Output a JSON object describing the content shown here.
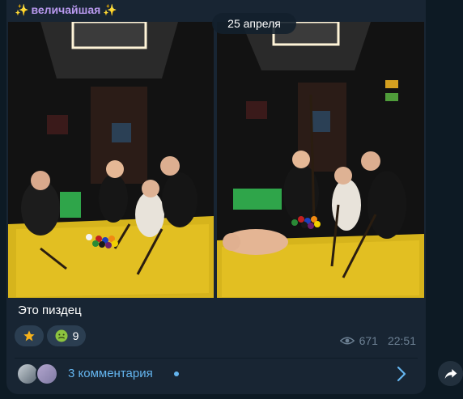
{
  "message": {
    "sender": "величайшая",
    "sender_color": "#b999ef",
    "date": "25 апреля",
    "caption": "Это пиздец",
    "views": "671",
    "time": "22:51",
    "reactions": [
      {
        "emoji": "star",
        "count": ""
      },
      {
        "emoji": "nauseated-face",
        "count": "9"
      }
    ],
    "comments_label": "3 комментария"
  },
  "colors": {
    "accent": "#64b5ef",
    "bubble": "#182533",
    "background": "#0d1a24"
  }
}
